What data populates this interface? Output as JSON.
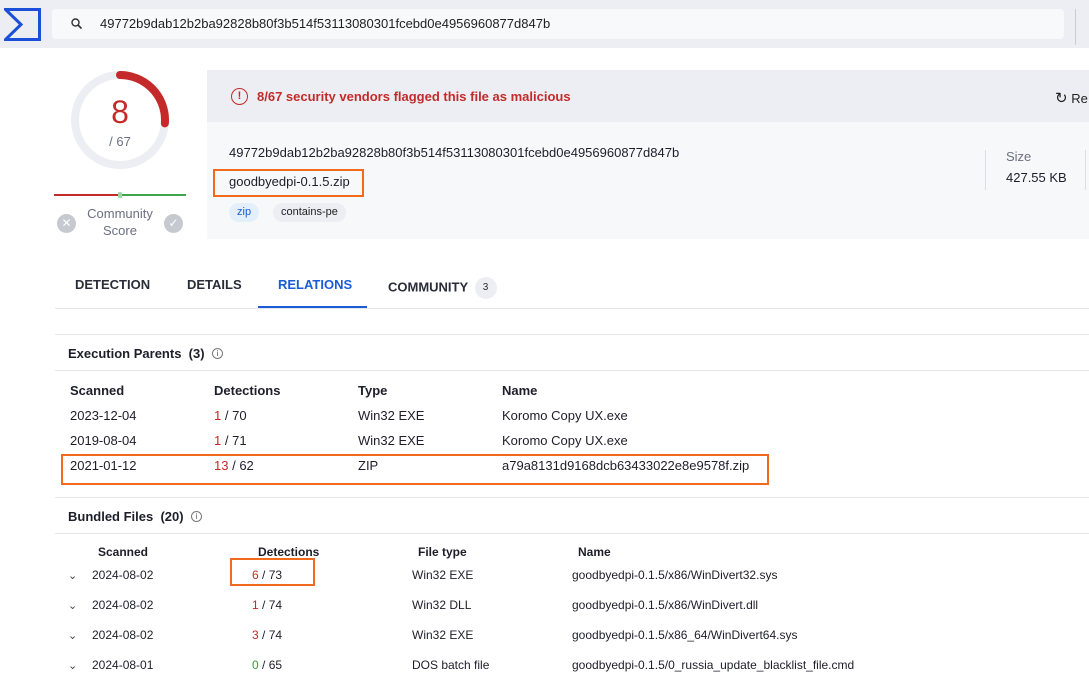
{
  "topbar": {
    "search_value": "49772b9dab12b2ba92828b80f3b514f53113080301fcebd0e4956960877d847b",
    "logo": "virustotal-logo",
    "search_icon": "search-icon"
  },
  "score": {
    "detected": "8",
    "total": "/ 67",
    "detected_fraction": 0.119,
    "community_label_1": "Community",
    "community_label_2": "Score",
    "community_position": 0.5
  },
  "alert": {
    "text": "8/67 security vendors flagged this file as malicious",
    "reanalyze": "Re"
  },
  "file": {
    "hash": "49772b9dab12b2ba92828b80f3b514f53113080301fcebd0e4956960877d847b",
    "name": "goodbyedpi-0.1.5.zip",
    "tags": [
      "zip",
      "contains-pe"
    ],
    "size_label": "Size",
    "size_value": "427.55 KB"
  },
  "tabs": [
    {
      "label": "DETECTION"
    },
    {
      "label": "DETAILS"
    },
    {
      "label": "RELATIONS",
      "active": true
    },
    {
      "label": "COMMUNITY",
      "badge": "3"
    }
  ],
  "execution_parents": {
    "title": "Execution Parents",
    "count": "(3)",
    "headers": [
      "Scanned",
      "Detections",
      "Type",
      "Name"
    ],
    "rows": [
      {
        "scanned": "2023-12-04",
        "det": "1",
        "total": "/ 70",
        "type": "Win32 EXE",
        "name": "Koromo Copy UX.exe"
      },
      {
        "scanned": "2019-08-04",
        "det": "1",
        "total": "/ 71",
        "type": "Win32 EXE",
        "name": "Koromo Copy UX.exe"
      },
      {
        "scanned": "2021-01-12",
        "det": "13",
        "total": "/ 62",
        "type": "ZIP",
        "name": "a79a8131d9168dcb63433022e8e9578f.zip",
        "highlighted": true
      }
    ]
  },
  "bundled_files": {
    "title": "Bundled Files",
    "count": "(20)",
    "headers": [
      "Scanned",
      "Detections",
      "File type",
      "Name"
    ],
    "rows": [
      {
        "scanned": "2024-08-02",
        "det": "6",
        "total": "/ 73",
        "type": "Win32 EXE",
        "name": "goodbyedpi-0.1.5/x86/WinDivert32.sys",
        "highlighted": true
      },
      {
        "scanned": "2024-08-02",
        "det": "1",
        "total": "/ 74",
        "type": "Win32 DLL",
        "name": "goodbyedpi-0.1.5/x86/WinDivert.dll"
      },
      {
        "scanned": "2024-08-02",
        "det": "3",
        "total": "/ 74",
        "type": "Win32 EXE",
        "name": "goodbyedpi-0.1.5/x86_64/WinDivert64.sys"
      },
      {
        "scanned": "2024-08-01",
        "det": "0",
        "total": "/ 65",
        "type": "DOS batch file",
        "name": "goodbyedpi-0.1.5/0_russia_update_blacklist_file.cmd"
      }
    ]
  },
  "colors": {
    "malicious": "#c52a2a",
    "clean": "#2e9a3a",
    "accent": "#1b5bd8",
    "highlight": "#f26a1b"
  }
}
